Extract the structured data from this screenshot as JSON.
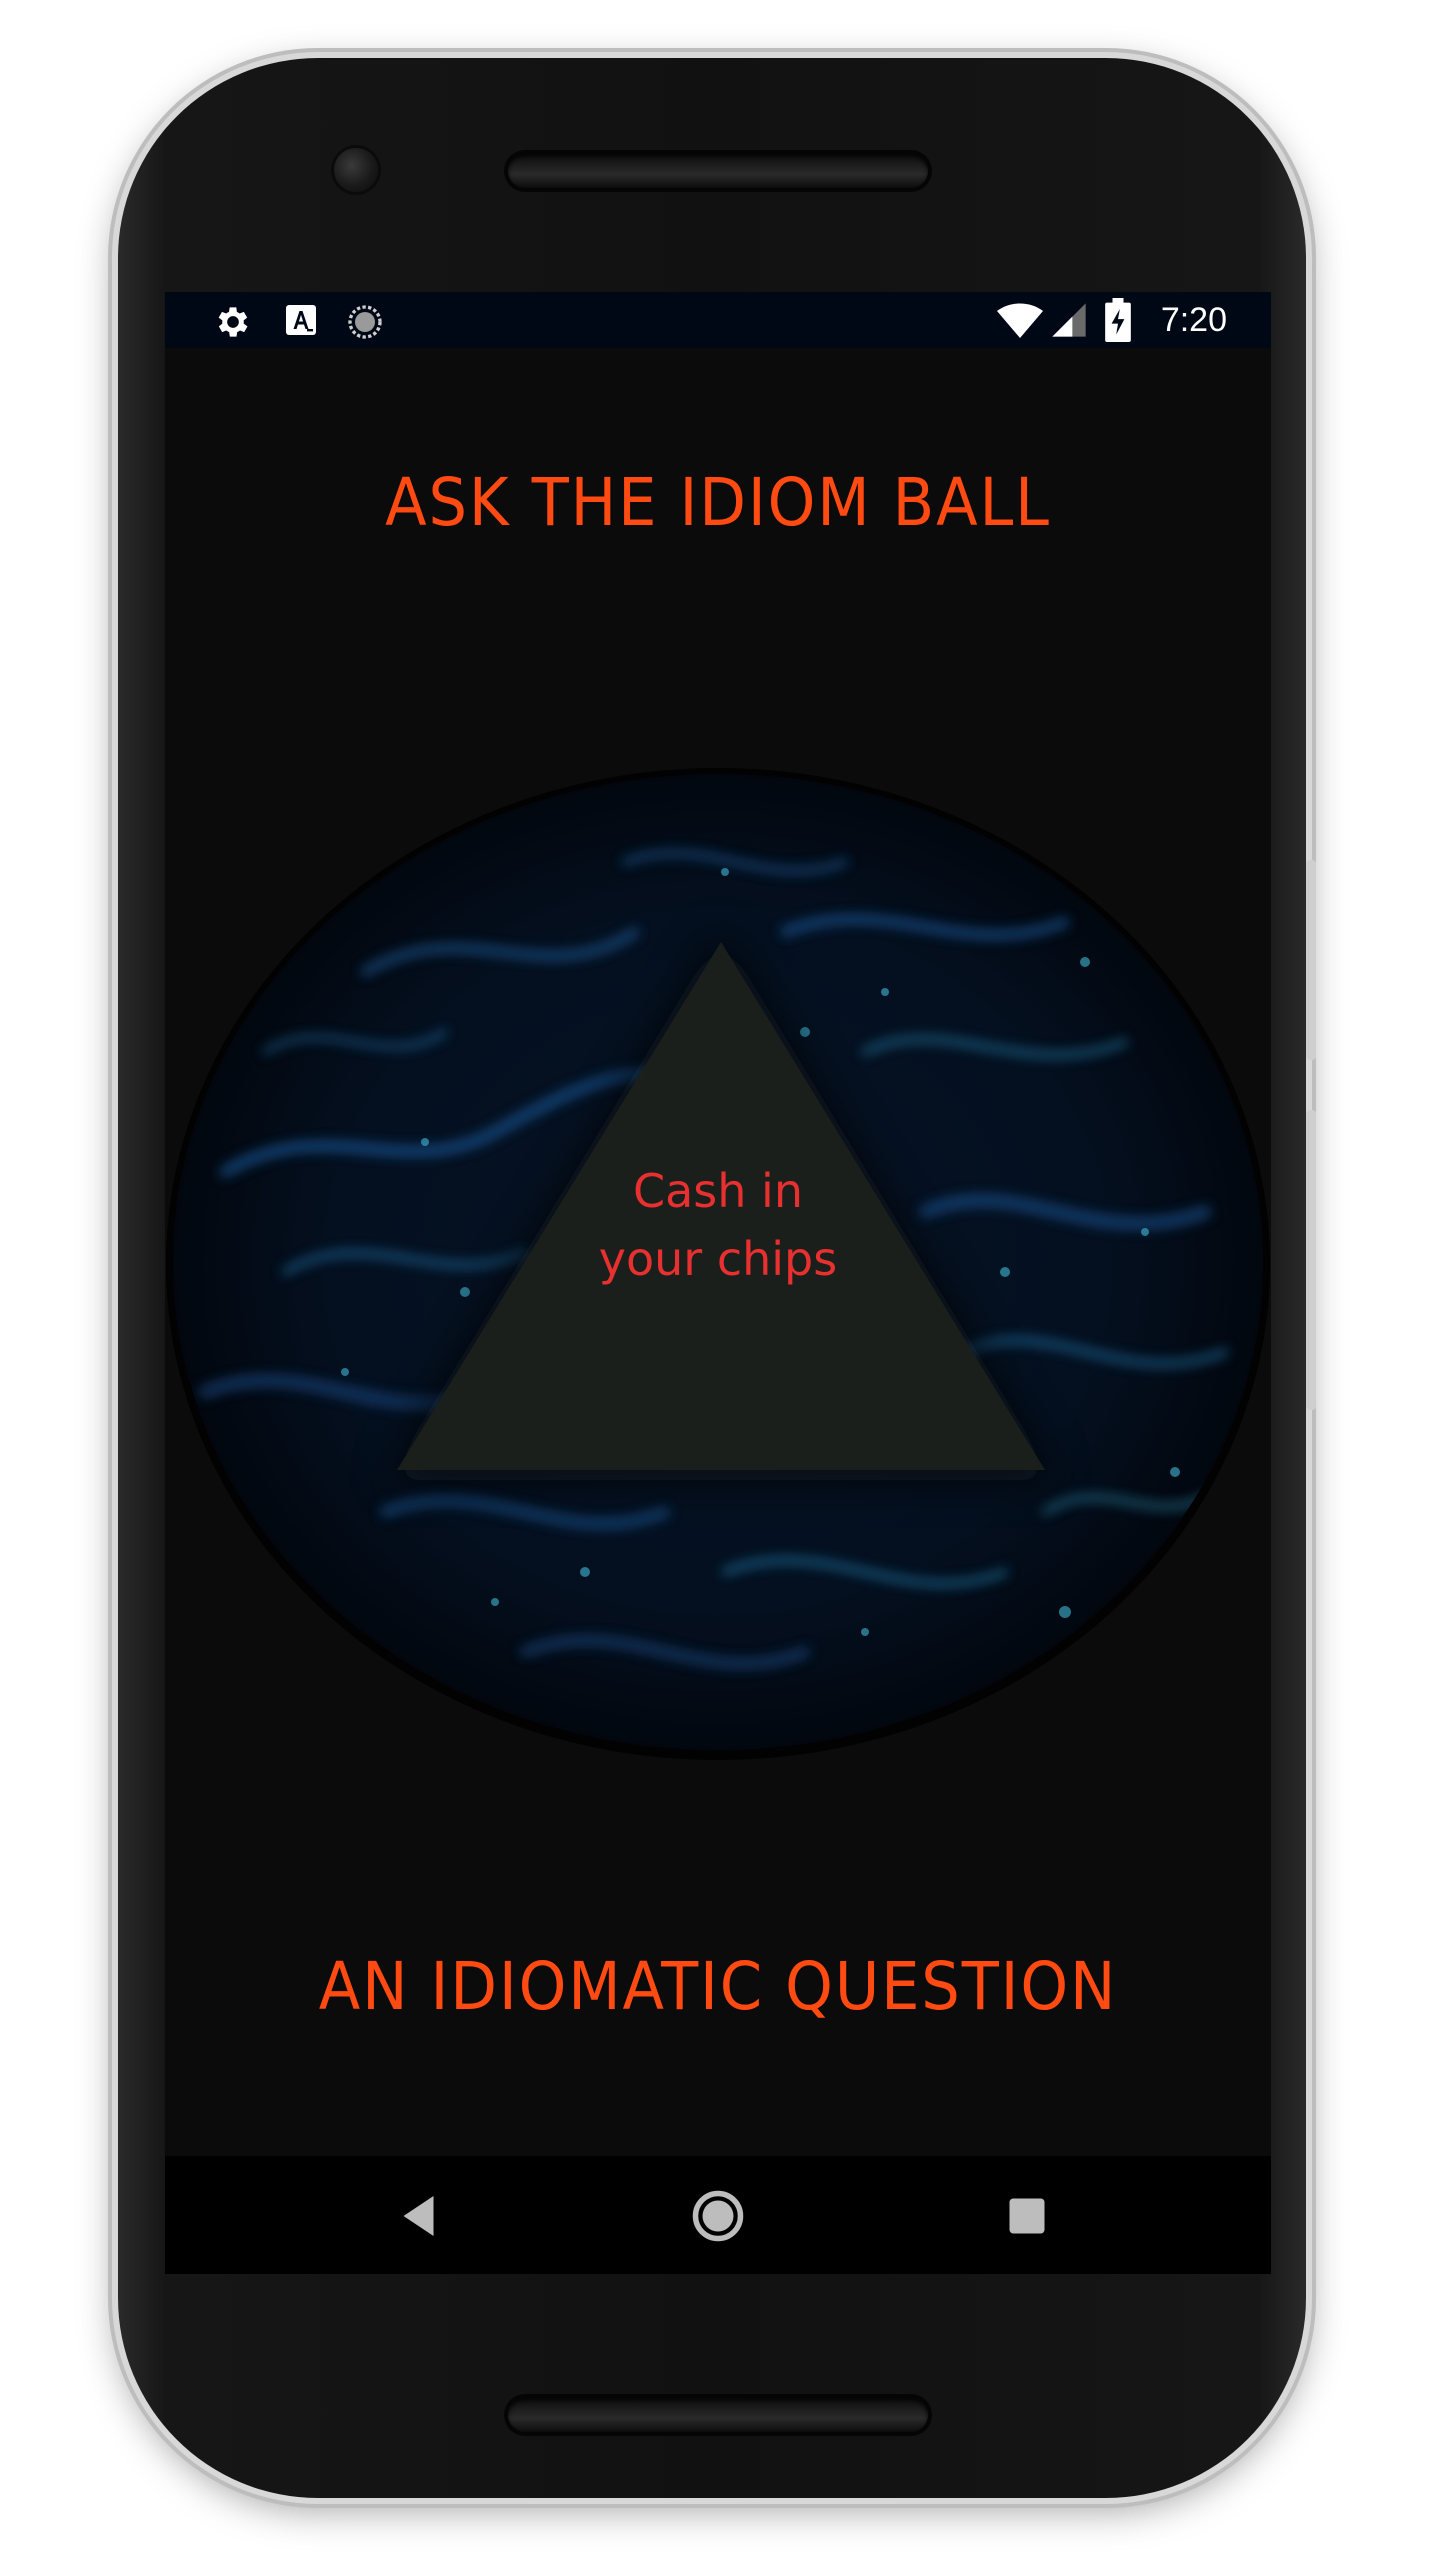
{
  "status_bar": {
    "time": "7:20",
    "icons": [
      "settings-icon",
      "font-a-icon",
      "sync-icon",
      "wifi-icon",
      "signal-icon",
      "battery-charging-icon"
    ]
  },
  "app": {
    "title": "ASK THE IDIOM BALL",
    "answer": "Cash in your chips",
    "answer_line1": "Cash in",
    "answer_line2": "your chips",
    "prompt": "AN IDIOMATIC QUESTION"
  },
  "nav_bar": {
    "buttons": [
      "back-icon",
      "home-icon",
      "recents-icon"
    ]
  },
  "colors": {
    "accent": "#ff4a12",
    "answer_text": "#e83030",
    "screen_bg": "#0b0b0c",
    "status_bar_bg": "#000815",
    "triangle": "#1c201c"
  }
}
